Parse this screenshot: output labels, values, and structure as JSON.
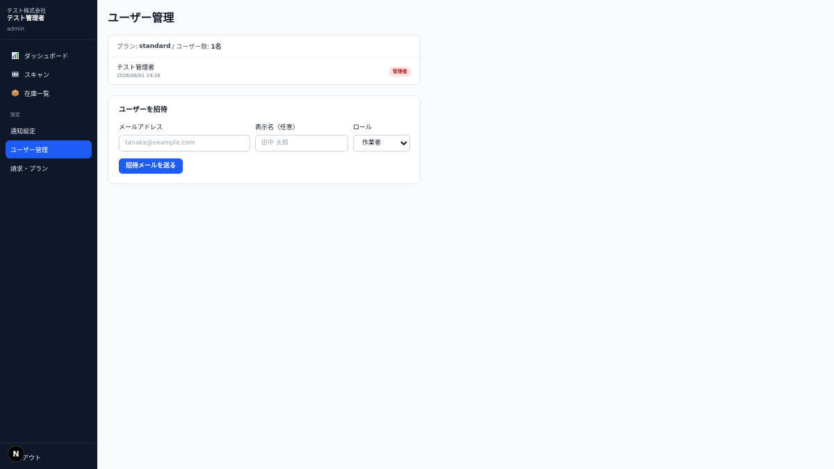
{
  "sidebar": {
    "company": "テスト株式会社",
    "admin_name": "テスト管理者",
    "role": "admin",
    "main_items": [
      {
        "label": "ダッシュボード",
        "icon": "chart-icon"
      },
      {
        "label": "スキャン",
        "icon": "barcode-icon"
      },
      {
        "label": "在庫一覧",
        "icon": "box-icon"
      }
    ],
    "section_label": "設定",
    "settings_items": [
      {
        "label": "通知設定"
      },
      {
        "label": "ユーザー管理",
        "active": true
      },
      {
        "label": "請求・プラン"
      }
    ],
    "footer_logout": "アウト",
    "footer_badge": "N"
  },
  "page": {
    "title": "ユーザー管理"
  },
  "plan": {
    "prefix": "プラン:",
    "plan_name": "standard",
    "separator": "/ ユーザー数:",
    "user_count": "1名"
  },
  "users": [
    {
      "name": "テスト管理者",
      "created": "2026/06/01 19:16",
      "role": "管理者"
    }
  ],
  "invite": {
    "title": "ユーザーを招待",
    "email_label": "メールアドレス",
    "email_placeholder": "tanaka@example.com",
    "name_label": "表示名（任意）",
    "name_placeholder": "田中 太郎",
    "role_label": "ロール",
    "role_value": "作業者",
    "submit_label": "招待メールを送る"
  },
  "colors": {
    "sidebar_bg": "#0f172a",
    "accent": "#1d5cf6",
    "admin_badge_bg": "#fee2e2",
    "admin_badge_text": "#b91c1c"
  }
}
